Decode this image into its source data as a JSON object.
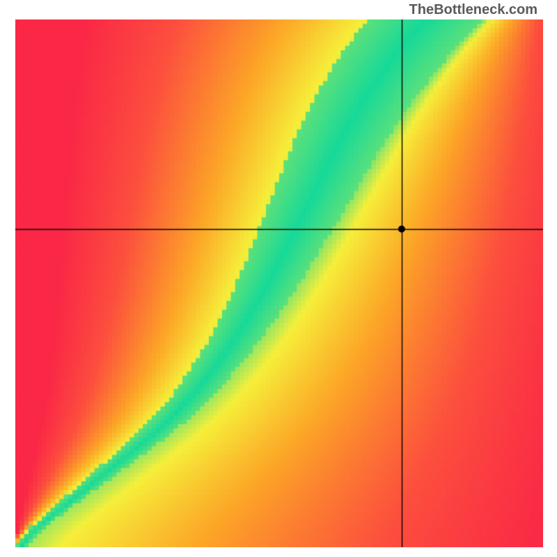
{
  "watermark": "TheBottleneck.com",
  "chart_data": {
    "type": "heatmap",
    "title": "",
    "xlabel": "",
    "ylabel": "",
    "xlim": [
      0,
      1
    ],
    "ylim": [
      0,
      1
    ],
    "marker": {
      "x": 0.732,
      "y": 0.603
    },
    "crosshair": {
      "x": 0.732,
      "y": 0.603
    },
    "ridge_curve_comment": "Normalized x positions (0=left,1=right) of the green optimal ridge at each normalized y (0=bottom,1=top). The heatmap colors encode distance from this ridge: green on it, yellow near, orange/red far.",
    "ridge_x_at_y": [
      0.01,
      0.025,
      0.045,
      0.07,
      0.095,
      0.12,
      0.145,
      0.17,
      0.195,
      0.22,
      0.245,
      0.268,
      0.29,
      0.31,
      0.328,
      0.346,
      0.362,
      0.378,
      0.392,
      0.406,
      0.42,
      0.432,
      0.444,
      0.456,
      0.468,
      0.478,
      0.489,
      0.5,
      0.51,
      0.52,
      0.53,
      0.54,
      0.55,
      0.56,
      0.57,
      0.58,
      0.59,
      0.6,
      0.61,
      0.621,
      0.632,
      0.644,
      0.656,
      0.668,
      0.682,
      0.696,
      0.71,
      0.726,
      0.742,
      0.76,
      0.78
    ],
    "band_halfwidth_at_y": [
      0.01,
      0.012,
      0.014,
      0.016,
      0.018,
      0.02,
      0.022,
      0.024,
      0.026,
      0.028,
      0.03,
      0.032,
      0.034,
      0.036,
      0.038,
      0.04,
      0.042,
      0.044,
      0.046,
      0.048,
      0.05,
      0.052,
      0.054,
      0.056,
      0.058,
      0.06,
      0.062,
      0.064,
      0.066,
      0.068,
      0.07,
      0.072,
      0.074,
      0.076,
      0.078,
      0.08,
      0.082,
      0.084,
      0.086,
      0.088,
      0.09,
      0.092,
      0.094,
      0.096,
      0.098,
      0.1,
      0.102,
      0.104,
      0.106,
      0.108,
      0.11
    ],
    "colors": {
      "ridge": "#16d999",
      "near": "#f6ef3a",
      "mid": "#fca627",
      "far": "#fc4f3e",
      "farthest": "#fa2846"
    }
  }
}
